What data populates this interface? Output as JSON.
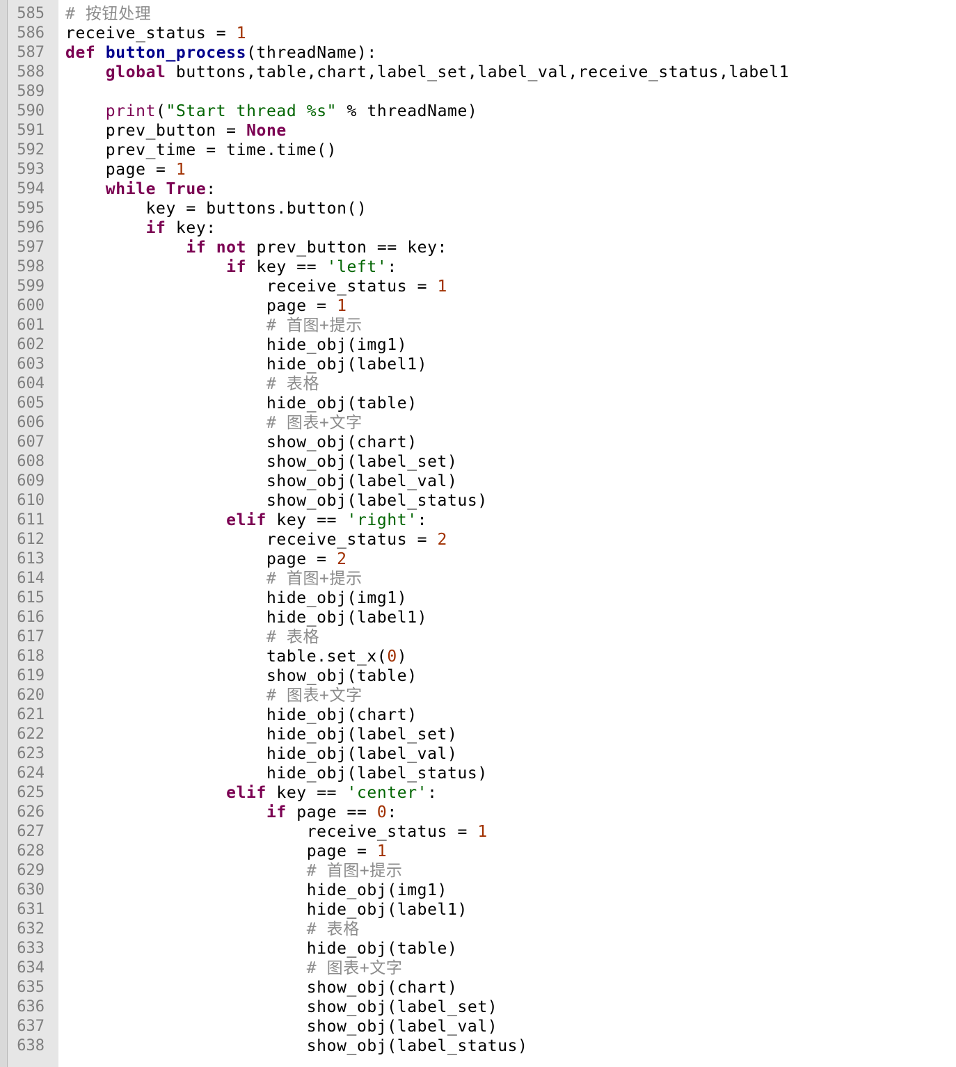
{
  "editor": {
    "colors": {
      "background": "#ffffff",
      "gutter": "#e6e6e6",
      "line_number": "#7f7f7f",
      "keyword": "#7b0052",
      "function_name": "#00008b",
      "string": "#006400",
      "number": "#a03000",
      "comment": "#8c8c8c",
      "text": "#000000"
    },
    "lines": [
      {
        "num": "585",
        "tokens": [
          {
            "t": "c",
            "v": "# 按钮处理"
          }
        ]
      },
      {
        "num": "586",
        "tokens": [
          {
            "t": "p",
            "v": "receive_status = "
          },
          {
            "t": "n",
            "v": "1"
          }
        ]
      },
      {
        "num": "587",
        "tokens": [
          {
            "t": "k",
            "v": "def "
          },
          {
            "t": "fn",
            "v": "button_process"
          },
          {
            "t": "p",
            "v": "(threadName):"
          }
        ]
      },
      {
        "num": "588",
        "tokens": [
          {
            "t": "p",
            "v": "    "
          },
          {
            "t": "k",
            "v": "global"
          },
          {
            "t": "p",
            "v": " buttons,table,chart,label_set,label_val,receive_status,label1"
          }
        ]
      },
      {
        "num": "589",
        "tokens": []
      },
      {
        "num": "590",
        "tokens": [
          {
            "t": "p",
            "v": "    "
          },
          {
            "t": "b",
            "v": "print"
          },
          {
            "t": "p",
            "v": "("
          },
          {
            "t": "s",
            "v": "\"Start thread %s\""
          },
          {
            "t": "p",
            "v": " % threadName)"
          }
        ]
      },
      {
        "num": "591",
        "tokens": [
          {
            "t": "p",
            "v": "    prev_button = "
          },
          {
            "t": "k",
            "v": "None"
          }
        ]
      },
      {
        "num": "592",
        "tokens": [
          {
            "t": "p",
            "v": "    prev_time = time.time()"
          }
        ]
      },
      {
        "num": "593",
        "tokens": [
          {
            "t": "p",
            "v": "    page = "
          },
          {
            "t": "n",
            "v": "1"
          }
        ]
      },
      {
        "num": "594",
        "tokens": [
          {
            "t": "p",
            "v": "    "
          },
          {
            "t": "k",
            "v": "while True"
          },
          {
            "t": "p",
            "v": ":"
          }
        ]
      },
      {
        "num": "595",
        "tokens": [
          {
            "t": "p",
            "v": "        key = buttons.button()"
          }
        ]
      },
      {
        "num": "596",
        "tokens": [
          {
            "t": "p",
            "v": "        "
          },
          {
            "t": "k",
            "v": "if"
          },
          {
            "t": "p",
            "v": " key:"
          }
        ]
      },
      {
        "num": "597",
        "tokens": [
          {
            "t": "p",
            "v": "            "
          },
          {
            "t": "k",
            "v": "if not"
          },
          {
            "t": "p",
            "v": " prev_button == key:"
          }
        ]
      },
      {
        "num": "598",
        "tokens": [
          {
            "t": "p",
            "v": "                "
          },
          {
            "t": "k",
            "v": "if"
          },
          {
            "t": "p",
            "v": " key == "
          },
          {
            "t": "s",
            "v": "'left'"
          },
          {
            "t": "p",
            "v": ":"
          }
        ]
      },
      {
        "num": "599",
        "tokens": [
          {
            "t": "p",
            "v": "                    receive_status = "
          },
          {
            "t": "n",
            "v": "1"
          }
        ]
      },
      {
        "num": "600",
        "tokens": [
          {
            "t": "p",
            "v": "                    page = "
          },
          {
            "t": "n",
            "v": "1"
          }
        ]
      },
      {
        "num": "601",
        "tokens": [
          {
            "t": "p",
            "v": "                    "
          },
          {
            "t": "c",
            "v": "# 首图+提示"
          }
        ]
      },
      {
        "num": "602",
        "tokens": [
          {
            "t": "p",
            "v": "                    hide_obj(img1)"
          }
        ]
      },
      {
        "num": "603",
        "tokens": [
          {
            "t": "p",
            "v": "                    hide_obj(label1)"
          }
        ]
      },
      {
        "num": "604",
        "tokens": [
          {
            "t": "p",
            "v": "                    "
          },
          {
            "t": "c",
            "v": "# 表格"
          }
        ]
      },
      {
        "num": "605",
        "tokens": [
          {
            "t": "p",
            "v": "                    hide_obj(table)"
          }
        ]
      },
      {
        "num": "606",
        "tokens": [
          {
            "t": "p",
            "v": "                    "
          },
          {
            "t": "c",
            "v": "# 图表+文字"
          }
        ]
      },
      {
        "num": "607",
        "tokens": [
          {
            "t": "p",
            "v": "                    show_obj(chart)"
          }
        ]
      },
      {
        "num": "608",
        "tokens": [
          {
            "t": "p",
            "v": "                    show_obj(label_set)"
          }
        ]
      },
      {
        "num": "609",
        "tokens": [
          {
            "t": "p",
            "v": "                    show_obj(label_val)"
          }
        ]
      },
      {
        "num": "610",
        "tokens": [
          {
            "t": "p",
            "v": "                    show_obj(label_status)"
          }
        ]
      },
      {
        "num": "611",
        "tokens": [
          {
            "t": "p",
            "v": "                "
          },
          {
            "t": "k",
            "v": "elif"
          },
          {
            "t": "p",
            "v": " key == "
          },
          {
            "t": "s",
            "v": "'right'"
          },
          {
            "t": "p",
            "v": ":"
          }
        ]
      },
      {
        "num": "612",
        "tokens": [
          {
            "t": "p",
            "v": "                    receive_status = "
          },
          {
            "t": "n",
            "v": "2"
          }
        ]
      },
      {
        "num": "613",
        "tokens": [
          {
            "t": "p",
            "v": "                    page = "
          },
          {
            "t": "n",
            "v": "2"
          }
        ]
      },
      {
        "num": "614",
        "tokens": [
          {
            "t": "p",
            "v": "                    "
          },
          {
            "t": "c",
            "v": "# 首图+提示"
          }
        ]
      },
      {
        "num": "615",
        "tokens": [
          {
            "t": "p",
            "v": "                    hide_obj(img1)"
          }
        ]
      },
      {
        "num": "616",
        "tokens": [
          {
            "t": "p",
            "v": "                    hide_obj(label1)"
          }
        ]
      },
      {
        "num": "617",
        "tokens": [
          {
            "t": "p",
            "v": "                    "
          },
          {
            "t": "c",
            "v": "# 表格"
          }
        ]
      },
      {
        "num": "618",
        "tokens": [
          {
            "t": "p",
            "v": "                    table.set_x("
          },
          {
            "t": "n",
            "v": "0"
          },
          {
            "t": "p",
            "v": ")"
          }
        ]
      },
      {
        "num": "619",
        "tokens": [
          {
            "t": "p",
            "v": "                    show_obj(table)"
          }
        ]
      },
      {
        "num": "620",
        "tokens": [
          {
            "t": "p",
            "v": "                    "
          },
          {
            "t": "c",
            "v": "# 图表+文字"
          }
        ]
      },
      {
        "num": "621",
        "tokens": [
          {
            "t": "p",
            "v": "                    hide_obj(chart)"
          }
        ]
      },
      {
        "num": "622",
        "tokens": [
          {
            "t": "p",
            "v": "                    hide_obj(label_set)"
          }
        ]
      },
      {
        "num": "623",
        "tokens": [
          {
            "t": "p",
            "v": "                    hide_obj(label_val)"
          }
        ]
      },
      {
        "num": "624",
        "tokens": [
          {
            "t": "p",
            "v": "                    hide_obj(label_status)"
          }
        ]
      },
      {
        "num": "625",
        "tokens": [
          {
            "t": "p",
            "v": "                "
          },
          {
            "t": "k",
            "v": "elif"
          },
          {
            "t": "p",
            "v": " key == "
          },
          {
            "t": "s",
            "v": "'center'"
          },
          {
            "t": "p",
            "v": ":"
          }
        ]
      },
      {
        "num": "626",
        "tokens": [
          {
            "t": "p",
            "v": "                    "
          },
          {
            "t": "k",
            "v": "if"
          },
          {
            "t": "p",
            "v": " page == "
          },
          {
            "t": "n",
            "v": "0"
          },
          {
            "t": "p",
            "v": ":"
          }
        ]
      },
      {
        "num": "627",
        "tokens": [
          {
            "t": "p",
            "v": "                        receive_status = "
          },
          {
            "t": "n",
            "v": "1"
          }
        ]
      },
      {
        "num": "628",
        "tokens": [
          {
            "t": "p",
            "v": "                        page = "
          },
          {
            "t": "n",
            "v": "1"
          }
        ]
      },
      {
        "num": "629",
        "tokens": [
          {
            "t": "p",
            "v": "                        "
          },
          {
            "t": "c",
            "v": "# 首图+提示"
          }
        ]
      },
      {
        "num": "630",
        "tokens": [
          {
            "t": "p",
            "v": "                        hide_obj(img1)"
          }
        ]
      },
      {
        "num": "631",
        "tokens": [
          {
            "t": "p",
            "v": "                        hide_obj(label1)"
          }
        ]
      },
      {
        "num": "632",
        "tokens": [
          {
            "t": "p",
            "v": "                        "
          },
          {
            "t": "c",
            "v": "# 表格"
          }
        ]
      },
      {
        "num": "633",
        "tokens": [
          {
            "t": "p",
            "v": "                        hide_obj(table)"
          }
        ]
      },
      {
        "num": "634",
        "tokens": [
          {
            "t": "p",
            "v": "                        "
          },
          {
            "t": "c",
            "v": "# 图表+文字"
          }
        ]
      },
      {
        "num": "635",
        "tokens": [
          {
            "t": "p",
            "v": "                        show_obj(chart)"
          }
        ]
      },
      {
        "num": "636",
        "tokens": [
          {
            "t": "p",
            "v": "                        show_obj(label_set)"
          }
        ]
      },
      {
        "num": "637",
        "tokens": [
          {
            "t": "p",
            "v": "                        show_obj(label_val)"
          }
        ]
      },
      {
        "num": "638",
        "tokens": [
          {
            "t": "p",
            "v": "                        show_obj(label_status)"
          }
        ]
      }
    ]
  }
}
